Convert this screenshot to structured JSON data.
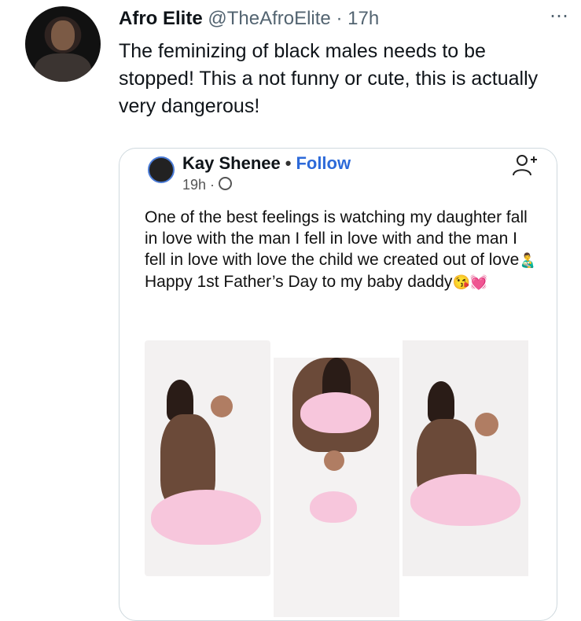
{
  "tweet": {
    "author_name": "Afro Elite",
    "author_handle": "@TheAfroElite",
    "dot": "·",
    "time": "17h",
    "more_icon": "⋯",
    "text": "The feminizing of black males needs to be stopped! This a not funny or cute, this is actually very dangerous!"
  },
  "embedded_post": {
    "name": "Kay Shenee",
    "separator": "•",
    "follow_label": "Follow",
    "time": "19h ·",
    "text_main": "One of the best feelings is watching my daughter fall in love with the man I fell in love with and the man I fell in love with love the child we created out of love",
    "emoji_1": "👨‍🍼",
    "text_tail": "Happy 1st Father’s Day to my baby daddy",
    "emoji_2": "😘💓"
  }
}
